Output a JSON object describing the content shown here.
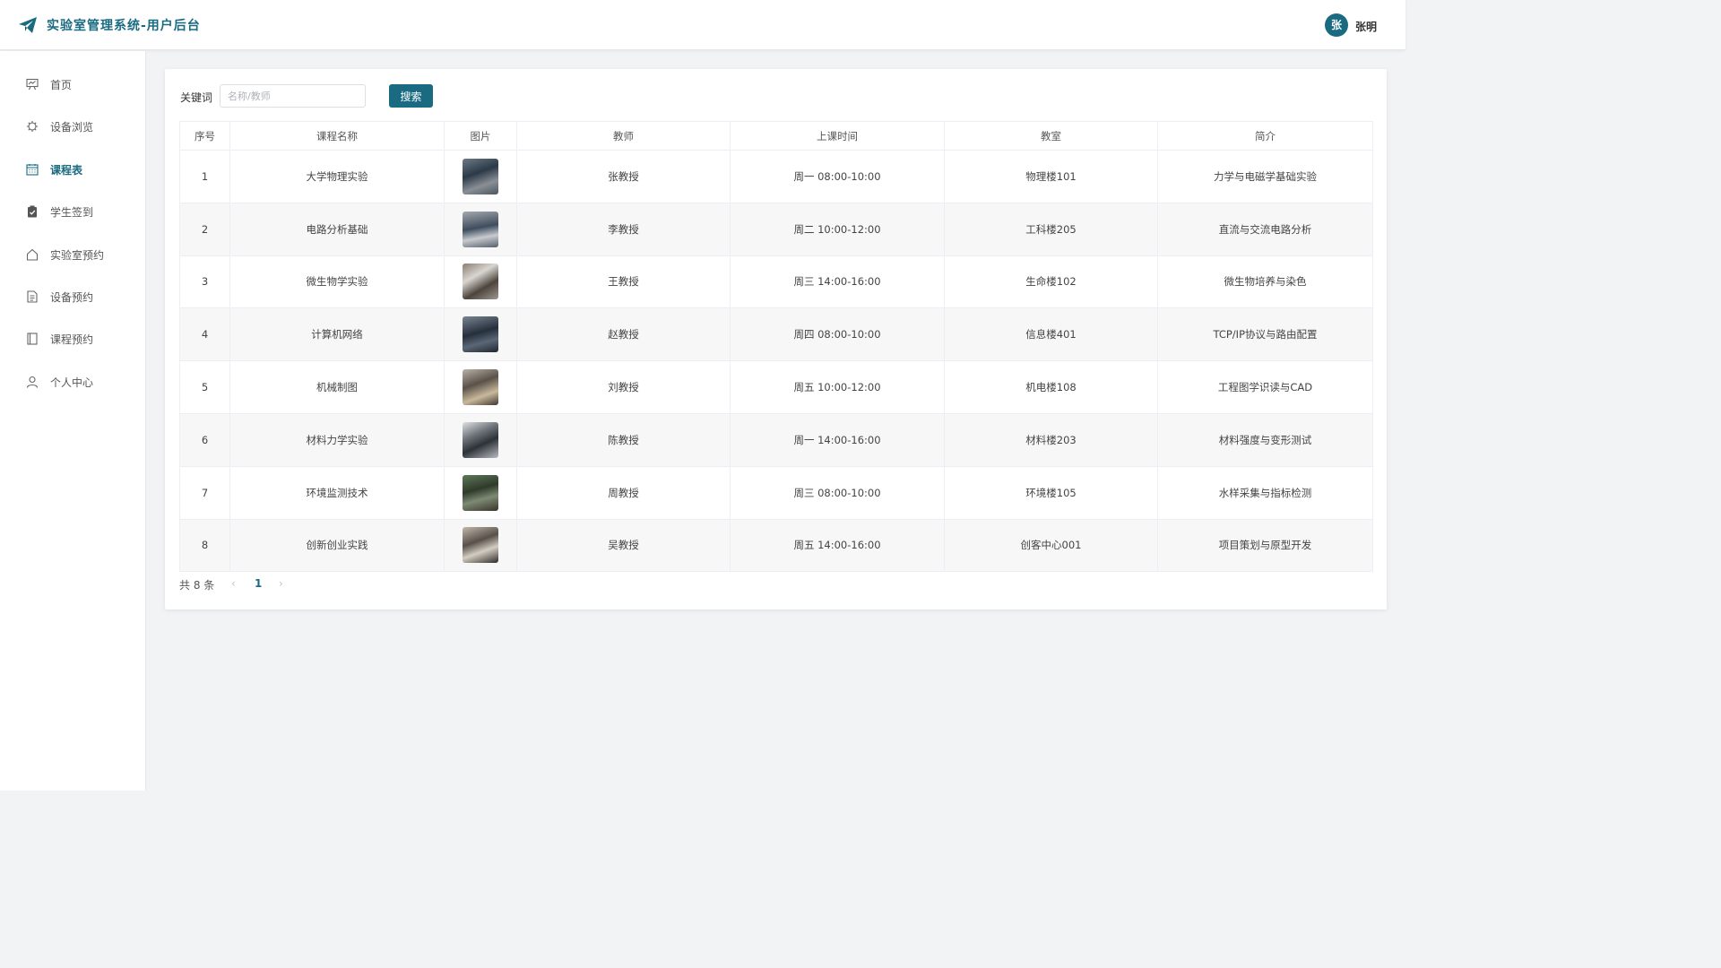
{
  "app": {
    "title": "实验室管理系统-用户后台",
    "user_avatar_char": "张",
    "user_name": "张明",
    "accent_color": "#1a6b82"
  },
  "sidebar": {
    "items": [
      {
        "label": "首页",
        "icon": "presentation-icon",
        "active": false
      },
      {
        "label": "设备浏览",
        "icon": "chip-icon",
        "active": false
      },
      {
        "label": "课程表",
        "icon": "calendar-icon",
        "active": true
      },
      {
        "label": "学生签到",
        "icon": "clipboard-check-icon",
        "active": false
      },
      {
        "label": "实验室预约",
        "icon": "home-icon",
        "active": false
      },
      {
        "label": "设备预约",
        "icon": "document-icon",
        "active": false
      },
      {
        "label": "课程预约",
        "icon": "notebook-icon",
        "active": false
      },
      {
        "label": "个人中心",
        "icon": "user-icon",
        "active": false
      }
    ]
  },
  "search": {
    "label": "关键词",
    "placeholder": "名称/教师",
    "value": "",
    "button_label": "搜索"
  },
  "table": {
    "headers": [
      "序号",
      "课程名称",
      "图片",
      "教师",
      "上课时间",
      "教室",
      "简介"
    ],
    "rows": [
      {
        "index": "1",
        "name": "大学物理实验",
        "teacher": "张教授",
        "time": "周一 08:00-10:00",
        "room": "物理楼101",
        "intro": "力学与电磁学基础实验"
      },
      {
        "index": "2",
        "name": "电路分析基础",
        "teacher": "李教授",
        "time": "周二 10:00-12:00",
        "room": "工科楼205",
        "intro": "直流与交流电路分析"
      },
      {
        "index": "3",
        "name": "微生物学实验",
        "teacher": "王教授",
        "time": "周三 14:00-16:00",
        "room": "生命楼102",
        "intro": "微生物培养与染色"
      },
      {
        "index": "4",
        "name": "计算机网络",
        "teacher": "赵教授",
        "time": "周四 08:00-10:00",
        "room": "信息楼401",
        "intro": "TCP/IP协议与路由配置"
      },
      {
        "index": "5",
        "name": "机械制图",
        "teacher": "刘教授",
        "time": "周五 10:00-12:00",
        "room": "机电楼108",
        "intro": "工程图学识读与CAD"
      },
      {
        "index": "6",
        "name": "材料力学实验",
        "teacher": "陈教授",
        "time": "周一 14:00-16:00",
        "room": "材料楼203",
        "intro": "材料强度与变形测试"
      },
      {
        "index": "7",
        "name": "环境监测技术",
        "teacher": "周教授",
        "time": "周三 08:00-10:00",
        "room": "环境楼105",
        "intro": "水样采集与指标检测"
      },
      {
        "index": "8",
        "name": "创新创业实践",
        "teacher": "吴教授",
        "time": "周五 14:00-16:00",
        "room": "创客中心001",
        "intro": "项目策划与原型开发"
      }
    ]
  },
  "pagination": {
    "total_text": "共 8 条",
    "prev": "‹",
    "current": "1",
    "next": "›"
  }
}
